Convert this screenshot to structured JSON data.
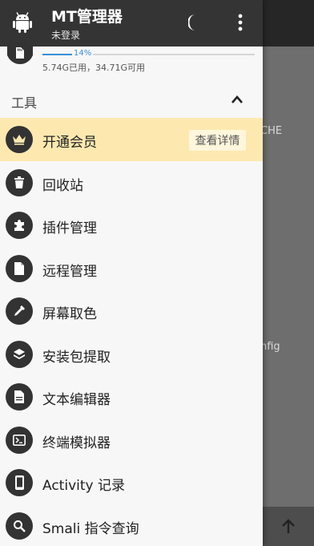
{
  "app": {
    "title": "MT管理器",
    "subtitle": "未登录"
  },
  "storage": {
    "percent_label": "14%",
    "percent_value": 14,
    "usage_text": "5.74G已用，34.71G可用"
  },
  "section": {
    "title": "工具"
  },
  "menu": {
    "items": [
      {
        "label": "开通会员",
        "icon": "crown-icon",
        "action_label": "查看详情"
      },
      {
        "label": "回收站",
        "icon": "trash-icon"
      },
      {
        "label": "插件管理",
        "icon": "puzzle-icon"
      },
      {
        "label": "远程管理",
        "icon": "file-icon"
      },
      {
        "label": "屏幕取色",
        "icon": "eyedropper-icon"
      },
      {
        "label": "安装包提取",
        "icon": "layers-icon"
      },
      {
        "label": "文本编辑器",
        "icon": "document-icon"
      },
      {
        "label": "终端模拟器",
        "icon": "terminal-icon"
      },
      {
        "label": "Activity 记录",
        "icon": "phone-icon"
      },
      {
        "label": "Smali 指令查询",
        "icon": "search-icon"
      }
    ]
  },
  "background": {
    "text_1": "CHE",
    "text_2": "nfig"
  },
  "colors": {
    "header": "#343434",
    "highlight": "#fde9b0",
    "accent": "#3a8fd6"
  }
}
